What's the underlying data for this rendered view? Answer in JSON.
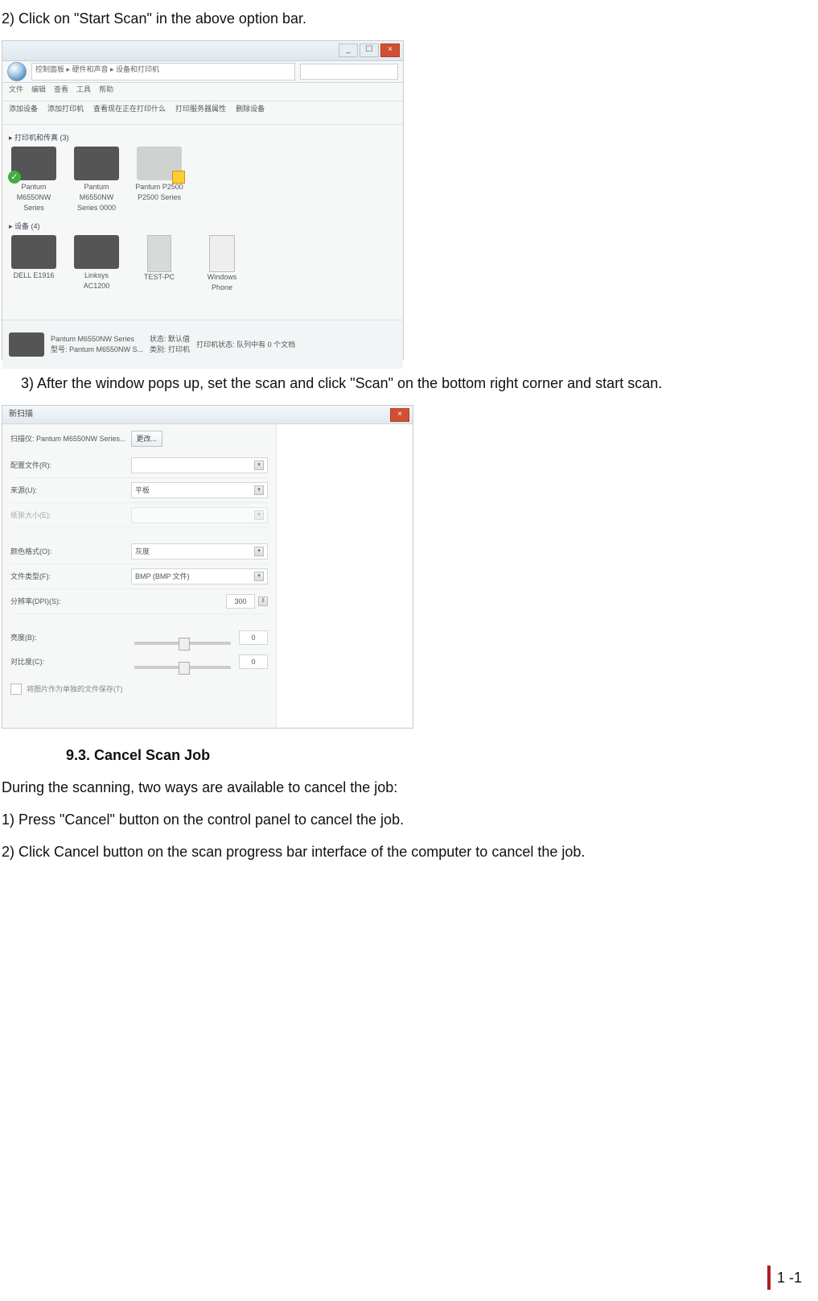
{
  "para_step2": "2) Click on \"Start Scan\" in the above option bar.",
  "para_step3": "3) After the window pops up, set the scan and click \"Scan\" on the bottom right corner and start scan.",
  "heading_cancel": "9.3. Cancel Scan Job",
  "cancel_intro": "During the scanning, two ways are available to cancel the job:",
  "cancel_1": "1) Press \"Cancel\" button on the control panel to cancel the job.",
  "cancel_2": "2) Click Cancel button on the scan progress bar interface of the computer to cancel the job.",
  "page_number": "1  -1",
  "win1": {
    "path": "控制面板 ▸ 硬件和声音 ▸ 设备和打印机",
    "menu": [
      "文件",
      "编辑",
      "查看",
      "工具",
      "帮助"
    ],
    "toolbar": [
      "添加设备",
      "添加打印机",
      "查看现在正在打印什么",
      "打印服务器属性",
      "删除设备"
    ],
    "section_printers": "▸ 打印机和传真 (3)",
    "section_devices": "▸ 设备 (4)",
    "printers": [
      "Pantum M6550NW Series",
      "Pantum M6550NW Series 0000",
      "Pantum P2500 P2500 Series"
    ],
    "devices": [
      "DELL E1916",
      "Linksys AC1200",
      "TEST-PC",
      "Windows Phone"
    ],
    "detail_name": "Pantum M6550NW Series",
    "detail_status": "状态: 默认值",
    "detail_model": "型号: Pantum M6550NW S...",
    "detail_cat": "类别: 打印机",
    "detail_note": "打印机状态: 队列中有 0 个文档"
  },
  "win2": {
    "title": "新扫描",
    "scanner_label": "扫描仪: Pantum M6550NW Series...",
    "change_btn": "更改...",
    "fields": [
      {
        "label": "配置文件(R):",
        "value": ""
      },
      {
        "label": "来源(U):",
        "value": "平板"
      },
      {
        "label": "纸张大小(E):",
        "value": "",
        "disabled": true
      },
      {
        "label": "颜色格式(O):",
        "value": "灰度"
      },
      {
        "label": "文件类型(F):",
        "value": "BMP (BMP 文件)"
      },
      {
        "label": "分辨率(DPI)(S):",
        "value": "300"
      }
    ],
    "brightness": "亮度(B):",
    "contrast": "对比度(C):",
    "zero": "0",
    "checkbox": "将图片作为单独的文件保存(T)"
  }
}
